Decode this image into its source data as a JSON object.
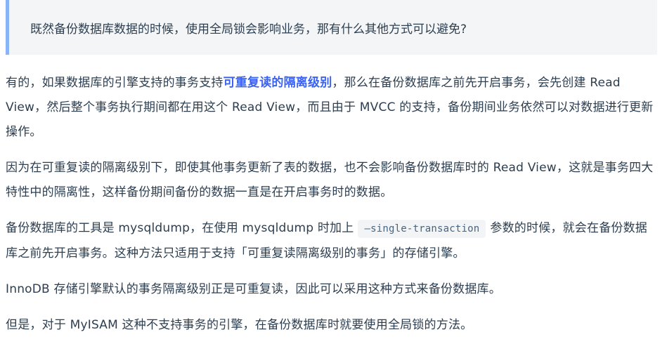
{
  "quote": {
    "text": "既然备份数据库数据的时候，使用全局锁会影响业务，那有什么其他方式可以避免?"
  },
  "paragraphs": {
    "p1": {
      "before": "有的，如果数据库的引擎支持的事务支持",
      "link": "可重复读的隔离级别",
      "after": "，那么在备份数据库之前先开启事务，会先创建 Read View，然后整个事务执行期间都在用这个 Read View，而且由于 MVCC 的支持，备份期间业务依然可以对数据进行更新操作。"
    },
    "p2": "因为在可重复读的隔离级别下，即使其他事务更新了表的数据，也不会影响备份数据库时的 Read View，这就是事务四大特性中的隔离性，这样备份期间备份的数据一直是在开启事务时的数据。",
    "p3": {
      "before": "备份数据库的工具是 mysqldump，在使用 mysqldump 时加上",
      "code": "–single-transaction",
      "after": "参数的时候，就会在备份数据库之前先开启事务。这种方法只适用于支持「可重复读隔离级别的事务」的存储引擎。"
    },
    "p4": "InnoDB 存储引擎默认的事务隔离级别正是可重复读，因此可以采用这种方式来备份数据库。",
    "p5": "但是，对于 MyISAM 这种不支持事务的引擎，在备份数据库时就要使用全局锁的方法。"
  },
  "colors": {
    "text": "#2c3e50",
    "link": "#3a63f5",
    "quote_border": "#8ab4f8",
    "quote_bg": "#f3f5f7",
    "code_bg": "#f2f4f5"
  }
}
